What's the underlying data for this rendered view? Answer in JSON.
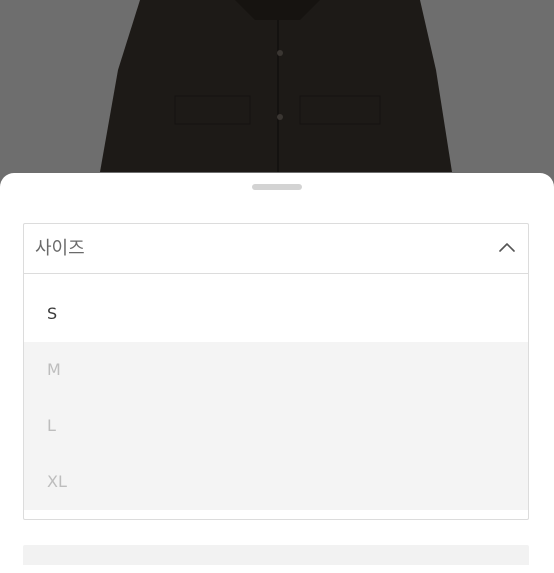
{
  "size_select": {
    "label": "사이즈",
    "expanded": true,
    "options": [
      {
        "label": "S",
        "available": true
      },
      {
        "label": "M",
        "available": false
      },
      {
        "label": "L",
        "available": false
      },
      {
        "label": "XL",
        "available": false
      }
    ]
  },
  "icons": {
    "collapse": "chevron-up-icon"
  },
  "colors": {
    "overlay": "#6b6b6b",
    "disabled_option_bg": "#f4f4f4",
    "disabled_option_text": "#bdbdbd",
    "border": "#dcdcdc"
  }
}
